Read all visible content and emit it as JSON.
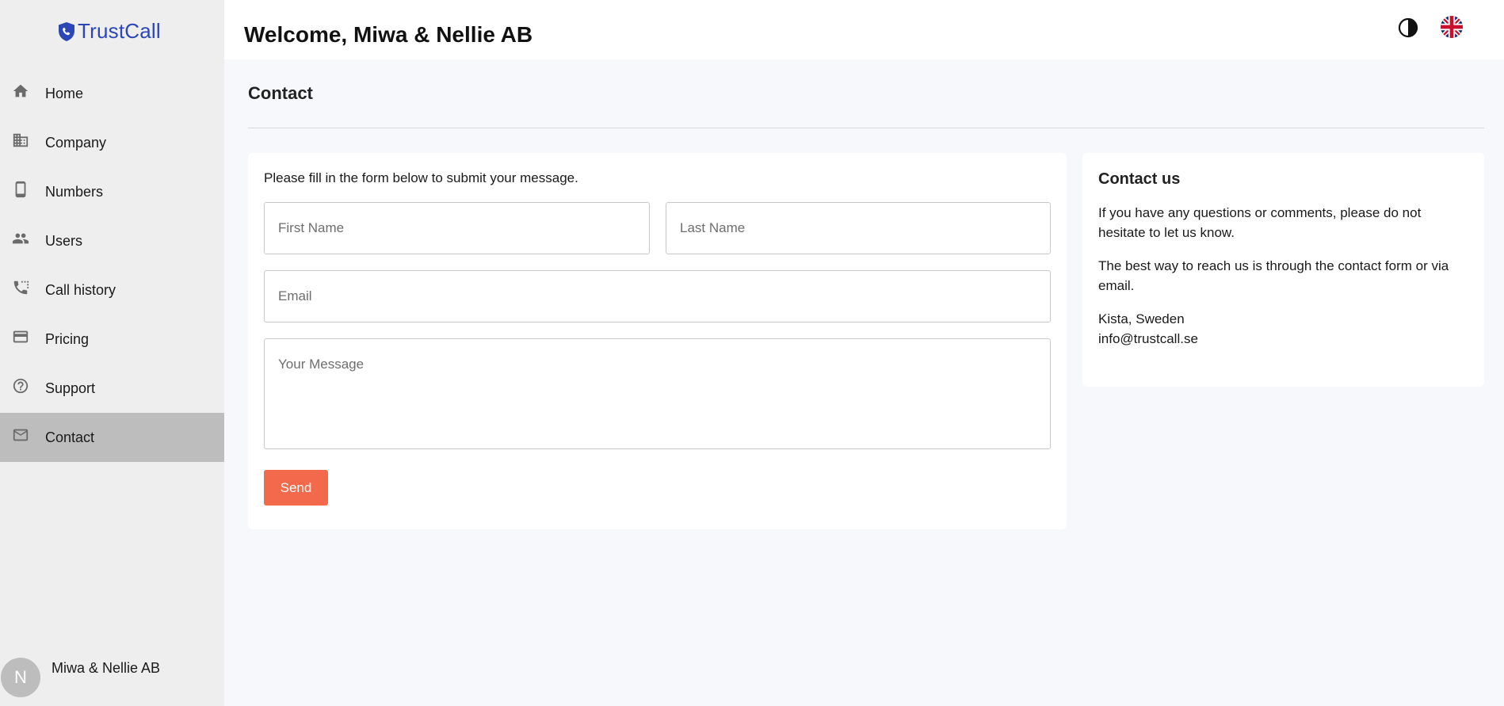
{
  "brand": {
    "name": "TrustCall",
    "color": "#2c46b5"
  },
  "sidebar": {
    "items": [
      {
        "label": "Home",
        "icon": "home-icon"
      },
      {
        "label": "Company",
        "icon": "building-icon"
      },
      {
        "label": "Numbers",
        "icon": "phone-device-icon"
      },
      {
        "label": "Users",
        "icon": "users-icon"
      },
      {
        "label": "Call history",
        "icon": "call-history-icon"
      },
      {
        "label": "Pricing",
        "icon": "credit-card-icon"
      },
      {
        "label": "Support",
        "icon": "help-circle-icon"
      },
      {
        "label": "Contact",
        "icon": "mail-icon",
        "active": true
      }
    ],
    "user": {
      "initial": "N",
      "name": "Miwa & Nellie AB"
    }
  },
  "header": {
    "welcome": "Welcome, Miwa & Nellie AB",
    "theme_icon": "contrast-icon",
    "language_icon": "uk-flag-icon"
  },
  "page": {
    "title": "Contact"
  },
  "form": {
    "intro": "Please fill in the form below to submit your message.",
    "first_name_placeholder": "First Name",
    "last_name_placeholder": "Last Name",
    "email_placeholder": "Email",
    "message_placeholder": "Your Message",
    "send_label": "Send",
    "accent_color": "#f26a4b"
  },
  "contact_info": {
    "title": "Contact us",
    "paragraph1": "If you have any questions or comments, please do not hesitate to let us know.",
    "paragraph2": "The best way to reach us is through the contact form or via email.",
    "location": "Kista, Sweden",
    "email": "info@trustcall.se"
  }
}
